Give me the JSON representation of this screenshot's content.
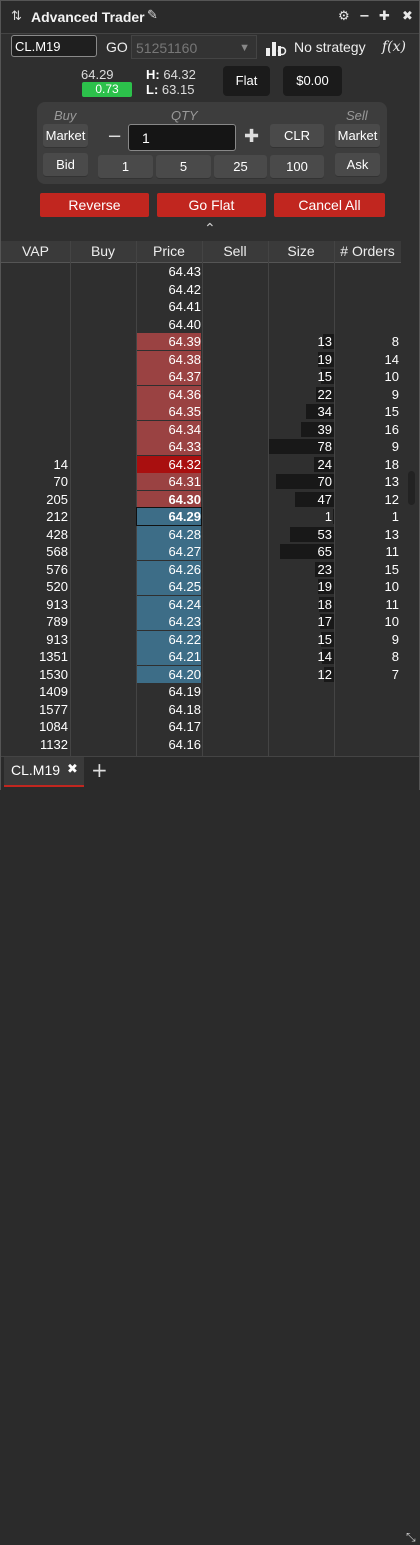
{
  "window": {
    "title": "Advanced Trader"
  },
  "toolbar": {
    "symbol": "CL.M19",
    "go_label": "GO",
    "account": "51251160",
    "strategy": "No strategy",
    "fx_label": "f(x)"
  },
  "quote": {
    "last": "64.29",
    "change": "0.73",
    "high_label": "H:",
    "high": "64.32",
    "low_label": "L:",
    "low": "63.15"
  },
  "position": {
    "status": "Flat",
    "pnl": "$0.00"
  },
  "order_panel": {
    "buy_label": "Buy",
    "qty_label": "QTY",
    "sell_label": "Sell",
    "buy_market": "Market",
    "buy_bid": "Bid",
    "sell_market": "Market",
    "sell_ask": "Ask",
    "qty_value": "1",
    "clr": "CLR",
    "presets": [
      "1",
      "5",
      "25",
      "100"
    ]
  },
  "actions": {
    "reverse": "Reverse",
    "go_flat": "Go Flat",
    "cancel_all": "Cancel All"
  },
  "ladder": {
    "columns": [
      "VAP",
      "Buy",
      "Price",
      "Sell",
      "Size",
      "# Orders"
    ],
    "rows": [
      {
        "vap": "",
        "price": "64.43",
        "size": "",
        "orders": "",
        "side": "none"
      },
      {
        "vap": "",
        "price": "64.42",
        "size": "",
        "orders": "",
        "side": "none"
      },
      {
        "vap": "",
        "price": "64.41",
        "size": "",
        "orders": "",
        "side": "none"
      },
      {
        "vap": "",
        "price": "64.40",
        "size": "",
        "orders": "",
        "side": "none"
      },
      {
        "vap": "",
        "price": "64.39",
        "size": "13",
        "orders": "8",
        "side": "ask"
      },
      {
        "vap": "",
        "price": "64.38",
        "size": "19",
        "orders": "14",
        "side": "ask"
      },
      {
        "vap": "",
        "price": "64.37",
        "size": "15",
        "orders": "10",
        "side": "ask"
      },
      {
        "vap": "",
        "price": "64.36",
        "size": "22",
        "orders": "9",
        "side": "ask"
      },
      {
        "vap": "",
        "price": "64.35",
        "size": "34",
        "orders": "15",
        "side": "ask"
      },
      {
        "vap": "",
        "price": "64.34",
        "size": "39",
        "orders": "16",
        "side": "ask"
      },
      {
        "vap": "",
        "price": "64.33",
        "size": "78",
        "orders": "9",
        "side": "ask"
      },
      {
        "vap": "14",
        "price": "64.32",
        "size": "24",
        "orders": "18",
        "side": "high"
      },
      {
        "vap": "70",
        "price": "64.31",
        "size": "70",
        "orders": "13",
        "side": "ask"
      },
      {
        "vap": "205",
        "price": "64.30",
        "size": "47",
        "orders": "12",
        "side": "bestask"
      },
      {
        "vap": "212",
        "price": "64.29",
        "size": "1",
        "orders": "1",
        "side": "last"
      },
      {
        "vap": "428",
        "price": "64.28",
        "size": "53",
        "orders": "13",
        "side": "bid"
      },
      {
        "vap": "568",
        "price": "64.27",
        "size": "65",
        "orders": "11",
        "side": "bid"
      },
      {
        "vap": "576",
        "price": "64.26",
        "size": "23",
        "orders": "15",
        "side": "bid"
      },
      {
        "vap": "520",
        "price": "64.25",
        "size": "19",
        "orders": "10",
        "side": "bid"
      },
      {
        "vap": "913",
        "price": "64.24",
        "size": "18",
        "orders": "11",
        "side": "bid"
      },
      {
        "vap": "789",
        "price": "64.23",
        "size": "17",
        "orders": "10",
        "side": "bid"
      },
      {
        "vap": "913",
        "price": "64.22",
        "size": "15",
        "orders": "9",
        "side": "bid"
      },
      {
        "vap": "1351",
        "price": "64.21",
        "size": "14",
        "orders": "8",
        "side": "bid"
      },
      {
        "vap": "1530",
        "price": "64.20",
        "size": "12",
        "orders": "7",
        "side": "bid"
      },
      {
        "vap": "1409",
        "price": "64.19",
        "size": "",
        "orders": "",
        "side": "none"
      },
      {
        "vap": "1577",
        "price": "64.18",
        "size": "",
        "orders": "",
        "side": "none"
      },
      {
        "vap": "1084",
        "price": "64.17",
        "size": "",
        "orders": "",
        "side": "none"
      },
      {
        "vap": "1132",
        "price": "64.16",
        "size": "",
        "orders": "",
        "side": "none"
      }
    ]
  },
  "tabs": [
    {
      "label": "CL.M19"
    }
  ],
  "colors": {
    "ask": "#9a4242",
    "high": "#a90f0f",
    "bid": "#3d6d87",
    "accent": "#c1261f",
    "change_up": "#2cc14b"
  }
}
